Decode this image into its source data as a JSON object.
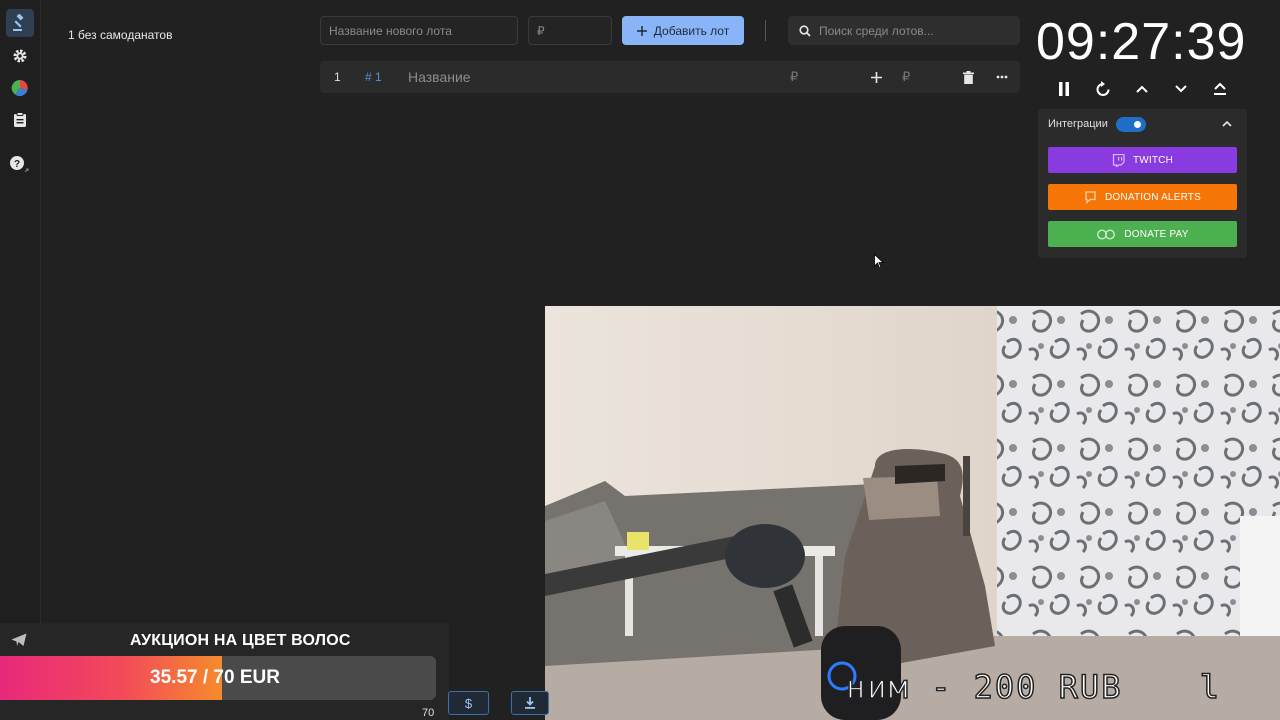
{
  "stats": {
    "text": "1 без самоданатов"
  },
  "form": {
    "name_placeholder": "Название нового лота",
    "amount_placeholder": "₽",
    "add_label": "Добавить лот",
    "search_placeholder": "Поиск среди лотов..."
  },
  "lot": {
    "number": "1",
    "id": "# 1",
    "name": "Название",
    "currency": "₽",
    "currency2": "₽"
  },
  "timer": {
    "value": "09:27:39"
  },
  "integrations": {
    "title": "Интеграции",
    "enabled": true,
    "twitch": "TWITCH",
    "donation_alerts": "DONATION ALERTS",
    "donate_pay": "DONATE PAY",
    "colors": {
      "twitch": "#8a3be0",
      "donation_alerts": "#f57507",
      "donate_pay": "#4caf50"
    }
  },
  "goal": {
    "title": "АУКЦИОН НА ЦВЕТ ВОЛОС",
    "progress": "35.57 / 70 EUR",
    "current": 35.57,
    "target": 70
  },
  "bottom": {
    "dollar": "$",
    "number": "70"
  },
  "overlay": {
    "text": "ним - 200 RUB",
    "cut": "l"
  }
}
